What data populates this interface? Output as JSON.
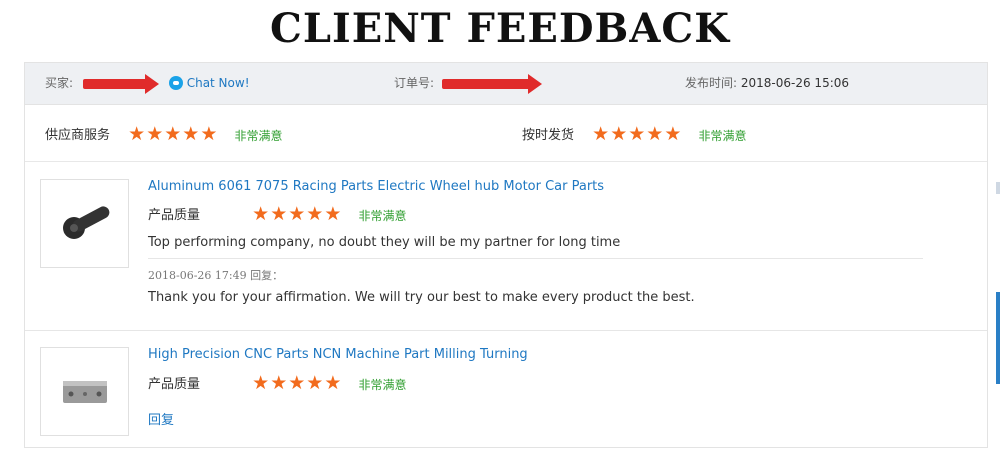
{
  "page_title": "CLIENT FEEDBACK",
  "header": {
    "buyer_label": "买家:",
    "chat_label": "Chat Now!",
    "order_label": "订单号:",
    "publish_label": "发布时间:",
    "publish_time": "2018-06-26 15:06"
  },
  "service_ratings": [
    {
      "label": "供应商服务",
      "stars": 5,
      "text": "非常满意"
    },
    {
      "label": "按时发货",
      "stars": 5,
      "text": "非常满意"
    }
  ],
  "products": [
    {
      "title": "Aluminum 6061 7075 Racing Parts Electric Wheel hub Motor Car Parts",
      "quality_label": "产品质量",
      "stars": 5,
      "rating_text": "非常满意",
      "comment": "Top performing company, no doubt they will be my partner for long time",
      "reply_meta": "2018-06-26 17:49  回复：",
      "reply_text": "Thank you for your affirmation. We will try our best to make every product the best."
    },
    {
      "title": "High Precision CNC Parts NCN Machine Part Milling Turning",
      "quality_label": "产品质量",
      "stars": 5,
      "rating_text": "非常满意",
      "reply_link": "回复"
    }
  ],
  "colors": {
    "star": "#f26b1d",
    "satisfied_text": "#2f9e2f",
    "link": "#1f78c2",
    "header_bg": "#eef0f3",
    "redaction_arrow": "#e02b2b"
  },
  "icons": [
    "chat-icon",
    "star-icon",
    "redaction-arrow"
  ]
}
